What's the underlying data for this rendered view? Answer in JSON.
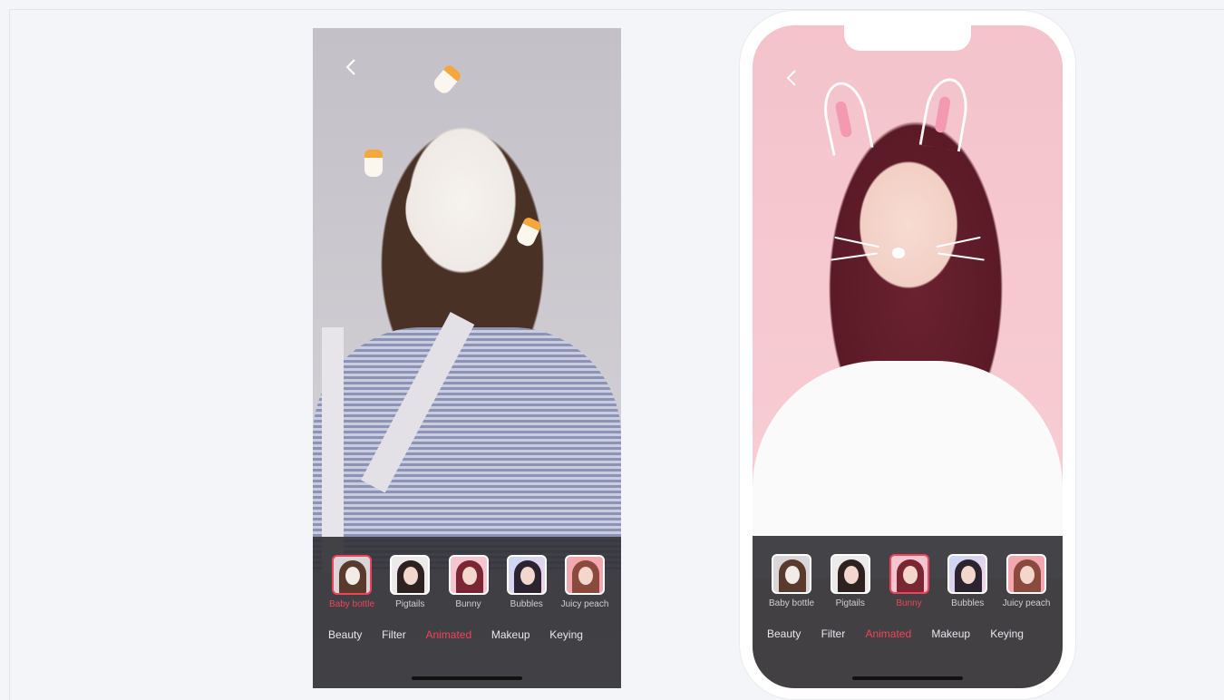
{
  "screens": [
    {
      "effects": [
        {
          "label": "Baby bottle",
          "selected": true
        },
        {
          "label": "Pigtails",
          "selected": false
        },
        {
          "label": "Bunny",
          "selected": false
        },
        {
          "label": "Bubbles",
          "selected": false
        },
        {
          "label": "Juicy peach",
          "selected": false
        }
      ],
      "tabs": [
        {
          "label": "Beauty"
        },
        {
          "label": "Filter"
        },
        {
          "label": "Animated",
          "active": true
        },
        {
          "label": "Makeup"
        },
        {
          "label": "Keying"
        }
      ]
    },
    {
      "effects": [
        {
          "label": "Baby bottle",
          "selected": false
        },
        {
          "label": "Pigtails",
          "selected": false
        },
        {
          "label": "Bunny",
          "selected": true
        },
        {
          "label": "Bubbles",
          "selected": false
        },
        {
          "label": "Juicy peach",
          "selected": false
        }
      ],
      "tabs": [
        {
          "label": "Beauty"
        },
        {
          "label": "Filter"
        },
        {
          "label": "Animated",
          "active": true
        },
        {
          "label": "Makeup"
        },
        {
          "label": "Keying"
        }
      ]
    }
  ],
  "colors": {
    "accent": "#f0435a",
    "panel": "#303034",
    "page_background": "#f4f5f9"
  },
  "icons": [
    "chevron-left-icon"
  ]
}
